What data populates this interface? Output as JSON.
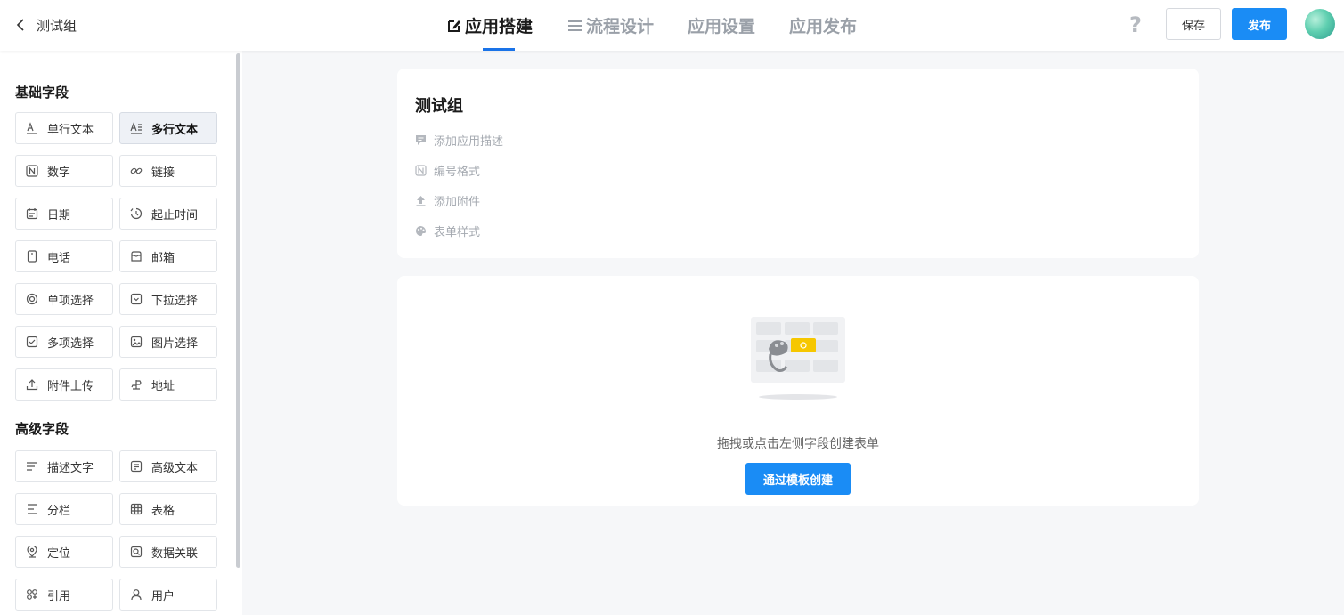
{
  "header": {
    "back_label": "测试组",
    "tabs": [
      {
        "label": "应用搭建"
      },
      {
        "label": "流程设计"
      },
      {
        "label": "应用设置"
      },
      {
        "label": "应用发布"
      }
    ],
    "help_label": "?",
    "save_label": "保存",
    "publish_label": "发布"
  },
  "sidebar": {
    "basic_title": "基础字段",
    "basic_fields": [
      {
        "label": "单行文本",
        "icon": "single-line-text-icon"
      },
      {
        "label": "多行文本",
        "icon": "multi-line-text-icon"
      },
      {
        "label": "数字",
        "icon": "number-icon"
      },
      {
        "label": "链接",
        "icon": "link-icon"
      },
      {
        "label": "日期",
        "icon": "calendar-icon"
      },
      {
        "label": "起止时间",
        "icon": "time-range-icon"
      },
      {
        "label": "电话",
        "icon": "phone-icon"
      },
      {
        "label": "邮箱",
        "icon": "mailbox-icon"
      },
      {
        "label": "单项选择",
        "icon": "radio-icon"
      },
      {
        "label": "下拉选择",
        "icon": "dropdown-icon"
      },
      {
        "label": "多项选择",
        "icon": "checkbox-icon"
      },
      {
        "label": "图片选择",
        "icon": "image-icon"
      },
      {
        "label": "附件上传",
        "icon": "upload-icon"
      },
      {
        "label": "地址",
        "icon": "address-icon"
      }
    ],
    "advanced_title": "高级字段",
    "advanced_fields": [
      {
        "label": "描述文字",
        "icon": "description-icon"
      },
      {
        "label": "高级文本",
        "icon": "rich-text-icon"
      },
      {
        "label": "分栏",
        "icon": "columns-icon"
      },
      {
        "label": "表格",
        "icon": "table-icon"
      },
      {
        "label": "定位",
        "icon": "location-icon"
      },
      {
        "label": "数据关联",
        "icon": "data-link-icon"
      },
      {
        "label": "引用",
        "icon": "reference-icon"
      },
      {
        "label": "用户",
        "icon": "user-icon"
      }
    ]
  },
  "form_header": {
    "title": "测试组",
    "options": [
      {
        "label": "添加应用描述",
        "icon": "comment-icon"
      },
      {
        "label": "编号格式",
        "icon": "number-format-icon"
      },
      {
        "label": "添加附件",
        "icon": "upload-icon"
      },
      {
        "label": "表单样式",
        "icon": "palette-icon"
      }
    ]
  },
  "empty_state": {
    "hint": "拖拽或点击左侧字段创建表单",
    "template_button": "通过模板创建"
  },
  "colors": {
    "primary": "#1a8cf5",
    "tab_underline": "#1a73e8",
    "background": "#f6f7f9"
  }
}
